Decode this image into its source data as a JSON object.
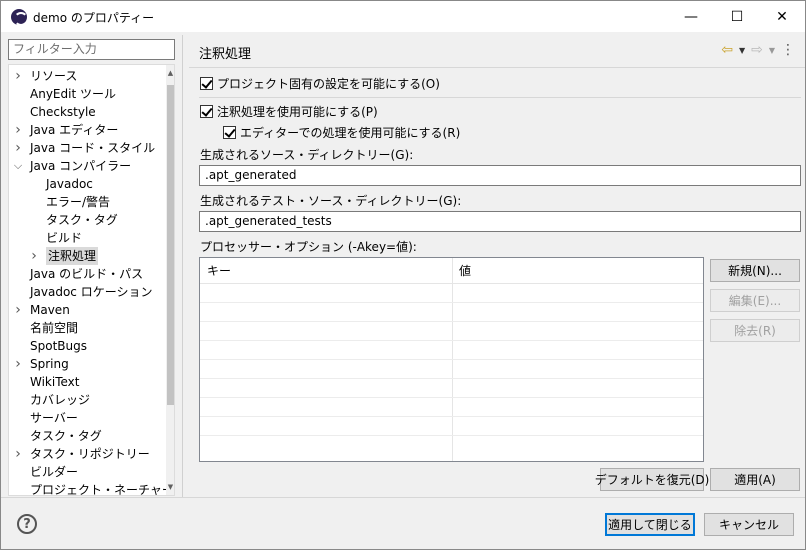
{
  "window": {
    "title": "demo のプロパティー",
    "minimize_glyph": "—",
    "maximize_glyph": "☐",
    "close_glyph": "✕"
  },
  "filter": {
    "placeholder": "フィルター入力"
  },
  "tree": {
    "items": [
      {
        "label": "リソース",
        "level": 0,
        "twisty": "collapsed"
      },
      {
        "label": "AnyEdit ツール",
        "level": 0,
        "twisty": "none"
      },
      {
        "label": "Checkstyle",
        "level": 0,
        "twisty": "none"
      },
      {
        "label": "Java エディター",
        "level": 0,
        "twisty": "collapsed"
      },
      {
        "label": "Java コード・スタイル",
        "level": 0,
        "twisty": "collapsed"
      },
      {
        "label": "Java コンパイラー",
        "level": 0,
        "twisty": "expanded"
      },
      {
        "label": "Javadoc",
        "level": 1,
        "twisty": "none"
      },
      {
        "label": "エラー/警告",
        "level": 1,
        "twisty": "none"
      },
      {
        "label": "タスク・タグ",
        "level": 1,
        "twisty": "none"
      },
      {
        "label": "ビルド",
        "level": 1,
        "twisty": "none"
      },
      {
        "label": "注釈処理",
        "level": 1,
        "twisty": "collapsed",
        "selected": true
      },
      {
        "label": "Java のビルド・パス",
        "level": 0,
        "twisty": "none"
      },
      {
        "label": "Javadoc ロケーション",
        "level": 0,
        "twisty": "none"
      },
      {
        "label": "Maven",
        "level": 0,
        "twisty": "collapsed"
      },
      {
        "label": "名前空間",
        "level": 0,
        "twisty": "none"
      },
      {
        "label": "SpotBugs",
        "level": 0,
        "twisty": "none"
      },
      {
        "label": "Spring",
        "level": 0,
        "twisty": "collapsed"
      },
      {
        "label": "WikiText",
        "level": 0,
        "twisty": "none"
      },
      {
        "label": "カバレッジ",
        "level": 0,
        "twisty": "none"
      },
      {
        "label": "サーバー",
        "level": 0,
        "twisty": "none"
      },
      {
        "label": "タスク・タグ",
        "level": 0,
        "twisty": "none"
      },
      {
        "label": "タスク・リポジトリー",
        "level": 0,
        "twisty": "collapsed"
      },
      {
        "label": "ビルダー",
        "level": 0,
        "twisty": "none"
      },
      {
        "label": "プロジェクト・ネーチャー",
        "level": 0,
        "twisty": "none"
      }
    ]
  },
  "page": {
    "title": "注釈処理",
    "project_specific": {
      "label": "プロジェクト固有の設定を可能にする(O)",
      "checked": true
    },
    "enable_processing": {
      "label": "注釈処理を使用可能にする(P)",
      "checked": true
    },
    "enable_in_editor": {
      "label": "エディターでの処理を使用可能にする(R)",
      "checked": true
    },
    "source_dir": {
      "label": "生成されるソース・ディレクトリー(G):",
      "value": ".apt_generated"
    },
    "test_source_dir": {
      "label": "生成されるテスト・ソース・ディレクトリー(G):",
      "value": ".apt_generated_tests"
    },
    "processor_options": {
      "label": "プロセッサー・オプション (-Akey=値):",
      "columns": [
        "キー",
        "値"
      ],
      "rows": []
    },
    "buttons": {
      "new": "新規(N)...",
      "edit": "編集(E)...",
      "remove": "除去(R)",
      "restore_defaults": "デフォルトを復元(D)",
      "apply": "適用(A)"
    }
  },
  "footer": {
    "help_glyph": "?",
    "apply_and_close": "適用して閉じる",
    "cancel": "キャンセル"
  },
  "colors": {
    "accent": "#0078d7",
    "selection": "#dadada",
    "nav_back": "#c9a22b"
  }
}
